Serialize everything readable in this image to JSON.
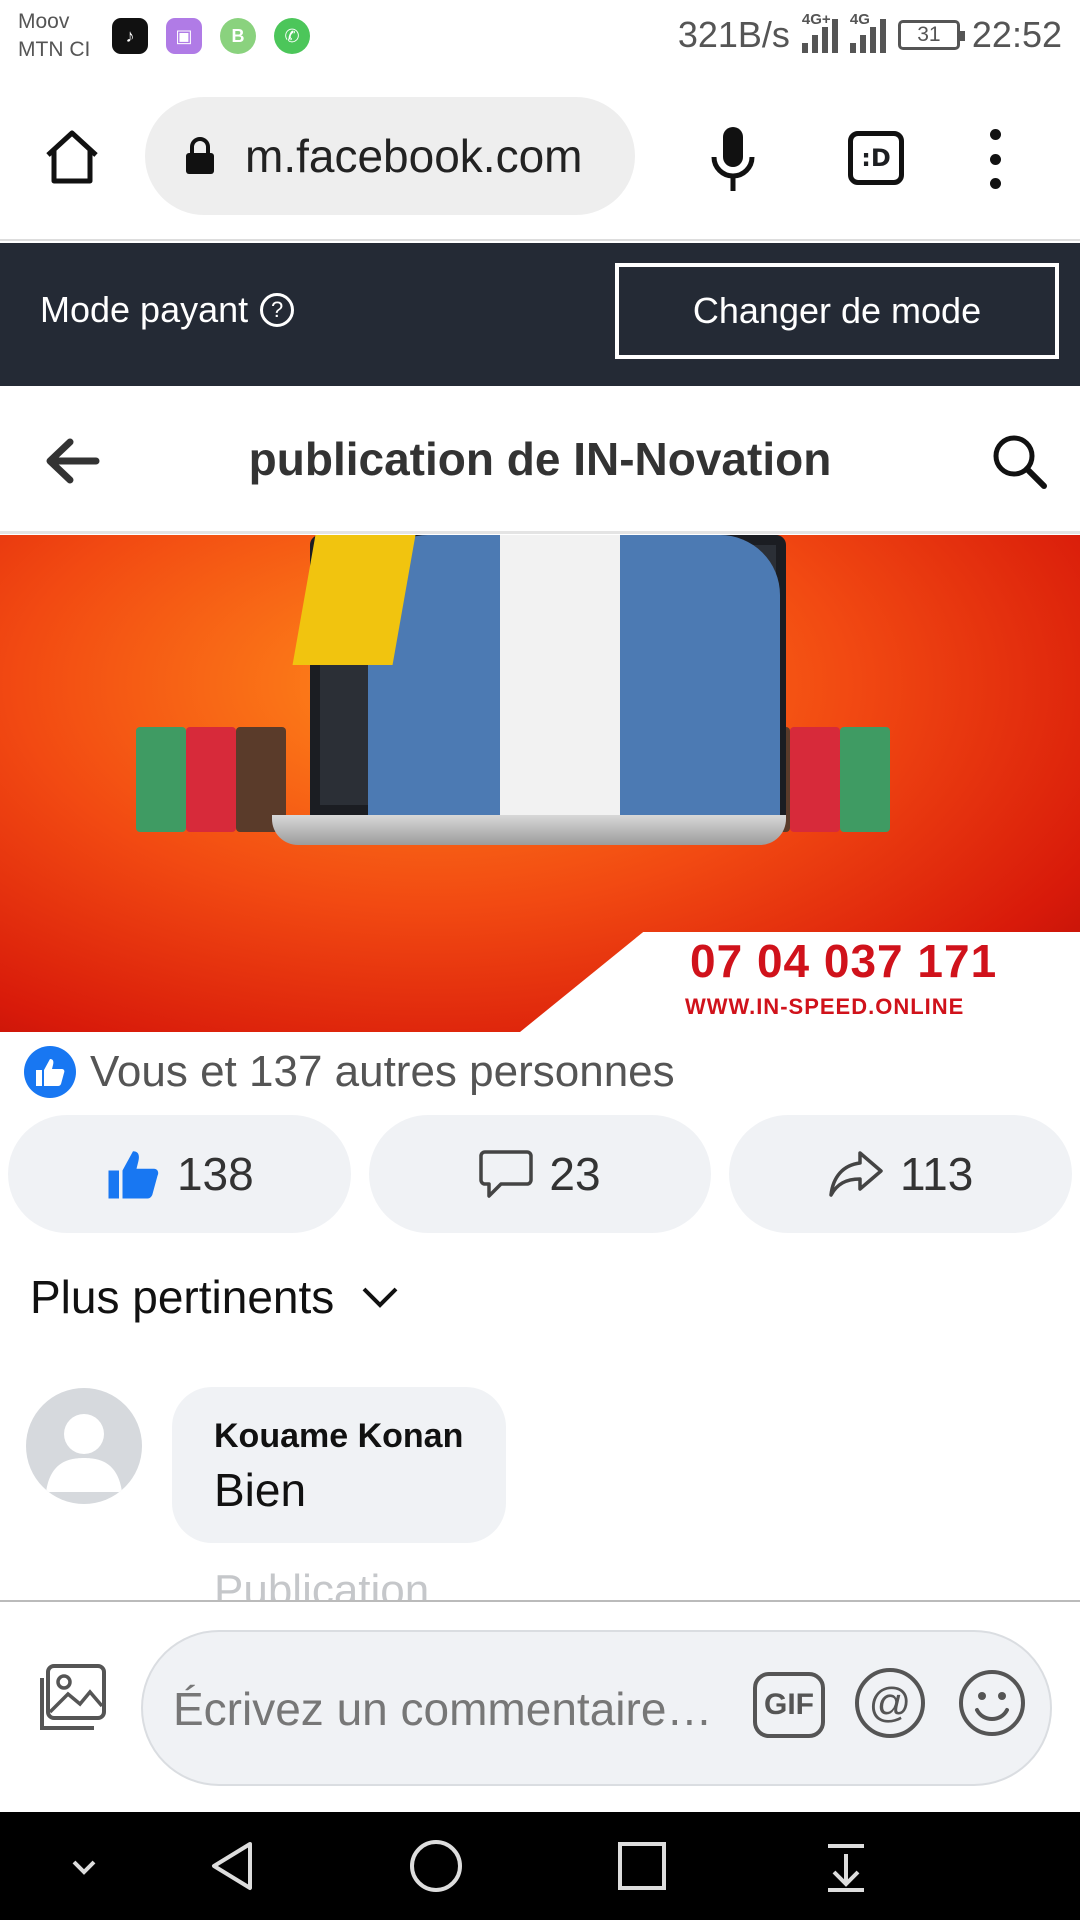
{
  "status_bar": {
    "carrier_1": "Moov",
    "carrier_2": "MTN CI",
    "apps": [
      "tiktok-icon",
      "gallery-icon",
      "b-app-icon",
      "whatsapp-icon"
    ],
    "net_speed": "321B/s",
    "signal_1_label": "4G+",
    "signal_2_label": "4G",
    "battery": "31",
    "time": "22:52"
  },
  "browser": {
    "url": "m.facebook.com",
    "tab_label": ":D"
  },
  "mode_banner": {
    "label": "Mode payant",
    "help": "?",
    "button": "Changer de mode",
    "bg_color": "#242a35"
  },
  "header": {
    "title": "publication de IN-Novation"
  },
  "post": {
    "image_phone": "07 04 037 171",
    "image_website": "WWW.IN-SPEED.ONLINE",
    "reactions_text": "Vous et 137 autres personnes",
    "actions": {
      "like_count": "138",
      "comment_count": "23",
      "share_count": "113"
    }
  },
  "comments": {
    "sort_label": "Plus pertinents",
    "items": [
      {
        "author": "Kouame Konan",
        "text": "Bien"
      }
    ],
    "faded_text": "Publication"
  },
  "composer": {
    "placeholder": "Écrivez un commentaire…",
    "gif_label": "GIF",
    "mention_label": "@"
  },
  "colors": {
    "facebook_blue": "#1877f2",
    "bubble_bg": "#f0f2f5",
    "image_red": "#d0121b"
  }
}
